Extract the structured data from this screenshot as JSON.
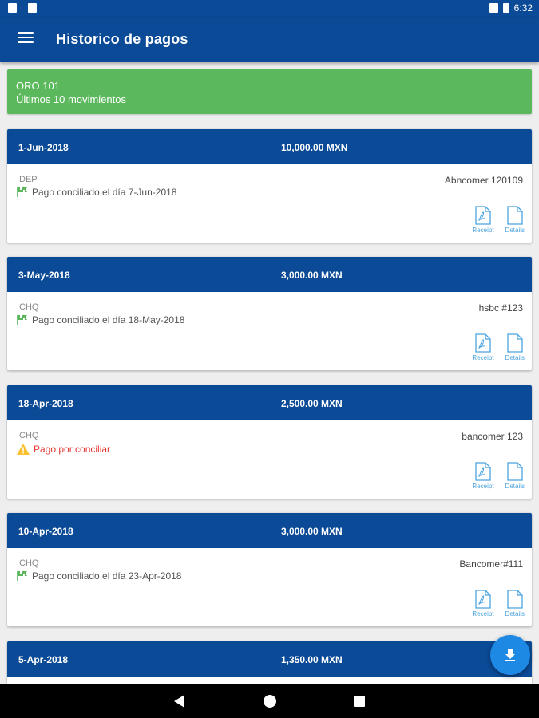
{
  "status_bar": {
    "time": "6:32"
  },
  "app_bar": {
    "title": "Historico de pagos",
    "menu_icon": "hamburger-menu-icon"
  },
  "banner": {
    "line1": "ORO 101",
    "line2": "Últimos 10 movimientos",
    "color": "#5cb85c"
  },
  "colors": {
    "primary": "#0b4a96",
    "accent": "#1e88e5",
    "link": "#4aa3df",
    "ok": "#5cb85c",
    "warn": "#e53935"
  },
  "payments": [
    {
      "date": "1-Jun-2018",
      "amount": "10,000.00 MXN",
      "type": "DEP",
      "status": "Pago conciliado el día 7-Jun-2018",
      "status_kind": "ok",
      "ref": "Abncomer 120109",
      "receipt": "Receipt",
      "details": "Details"
    },
    {
      "date": "3-May-2018",
      "amount": "3,000.00 MXN",
      "type": "CHQ",
      "status": "Pago conciliado el día 18-May-2018",
      "status_kind": "ok",
      "ref": "hsbc #123",
      "receipt": "Receipt",
      "details": "Details"
    },
    {
      "date": "18-Apr-2018",
      "amount": "2,500.00 MXN",
      "type": "CHQ",
      "status": "Pago por conciliar",
      "status_kind": "pending",
      "ref": "bancomer 123",
      "receipt": "Receipt",
      "details": "Details"
    },
    {
      "date": "10-Apr-2018",
      "amount": "3,000.00 MXN",
      "type": "CHQ",
      "status": "Pago conciliado el día 23-Apr-2018",
      "status_kind": "ok",
      "ref": "Bancomer#111",
      "receipt": "Receipt",
      "details": "Details"
    },
    {
      "date": "5-Apr-2018",
      "amount": "1,350.00 MXN"
    }
  ],
  "fab": {
    "icon": "download-icon"
  },
  "nav": {
    "back_icon": "back-icon",
    "home_icon": "home-icon",
    "recent_icon": "recent-apps-icon"
  }
}
